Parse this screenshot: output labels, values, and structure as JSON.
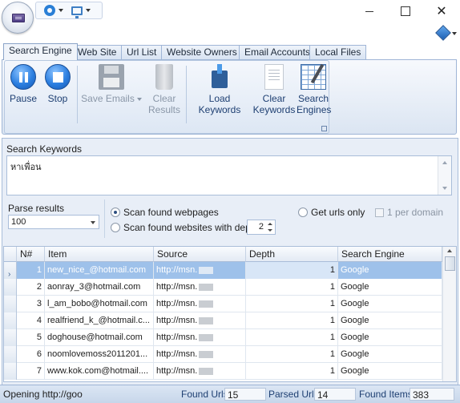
{
  "window": {
    "qat": {
      "options_icon": "gear-icon",
      "view_icon": "monitor-icon"
    },
    "controls": {
      "minimize": "minimize-icon",
      "maximize": "maximize-icon",
      "close": "✕"
    }
  },
  "tabs": [
    "Search Engine",
    "Web Site",
    "Url List",
    "Website Owners",
    "Email Accounts",
    "Local Files"
  ],
  "active_tab": "Search Engine",
  "ribbon": {
    "pause": "Pause",
    "stop": "Stop",
    "save_emails": "Save Emails",
    "clear_results_1": "Clear",
    "clear_results_2": "Results",
    "load_keywords": "Load Keywords",
    "clear_keywords_1": "Clear",
    "clear_keywords_2": "Keywords",
    "search_engines_1": "Search",
    "search_engines_2": "Engines"
  },
  "keywords": {
    "label": "Search Keywords",
    "value": "หาเพื่อน"
  },
  "parse": {
    "label": "Parse results",
    "value": "100"
  },
  "options": {
    "scan_found_webpages": "Scan found webpages",
    "scan_with_depth": "Scan found websites with depth",
    "depth_value": "2",
    "get_urls_only": "Get urls only",
    "per_domain": "1 per domain",
    "selected": "scan_found_webpages"
  },
  "grid": {
    "columns": [
      "N#",
      "Item",
      "Source",
      "Depth",
      "Search Engine"
    ],
    "rows": [
      {
        "n": "1",
        "item": "new_nice_@hotmail.com",
        "source": "http://msn.",
        "depth": "1",
        "engine": "Google",
        "selected": true
      },
      {
        "n": "2",
        "item": "aonray_3@hotmail.com",
        "source": "http://msn.",
        "depth": "1",
        "engine": "Google",
        "selected": false
      },
      {
        "n": "3",
        "item": "l_am_bobo@hotmail.com",
        "source": "http://msn.",
        "depth": "1",
        "engine": "Google",
        "selected": false
      },
      {
        "n": "4",
        "item": "realfriend_k_@hotmail.c...",
        "source": "http://msn.",
        "depth": "1",
        "engine": "Google",
        "selected": false
      },
      {
        "n": "5",
        "item": "doghouse@hotmail.com",
        "source": "http://msn.",
        "depth": "1",
        "engine": "Google",
        "selected": false
      },
      {
        "n": "6",
        "item": "noomlovemoss2011201...",
        "source": "http://msn.",
        "depth": "1",
        "engine": "Google",
        "selected": false
      },
      {
        "n": "7",
        "item": "www.kok.com@hotmail....",
        "source": "http://msn.",
        "depth": "1",
        "engine": "Google",
        "selected": false
      }
    ]
  },
  "status": {
    "message": "Opening http://goo",
    "found_urls_label": "Found Urls",
    "found_urls": "15",
    "parsed_urls_label": "Parsed Urls",
    "parsed_urls": "14",
    "found_items_label": "Found Items",
    "found_items": "383"
  }
}
